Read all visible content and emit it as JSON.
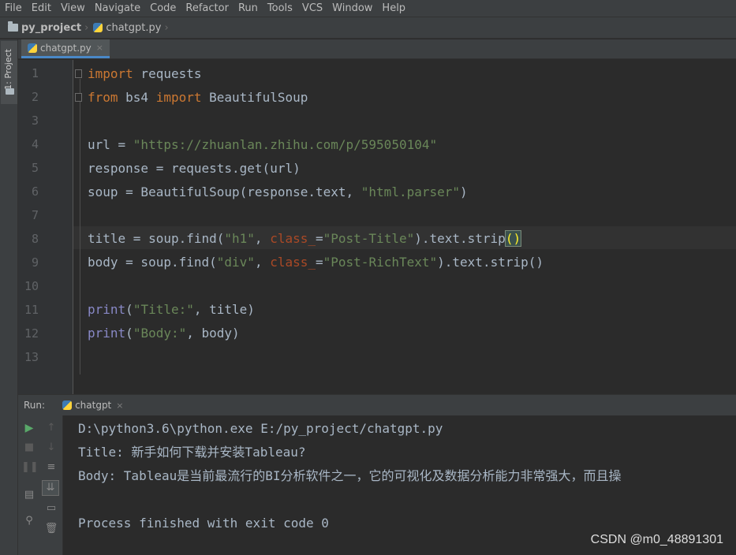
{
  "menu": [
    "File",
    "Edit",
    "View",
    "Navigate",
    "Code",
    "Refactor",
    "Run",
    "Tools",
    "VCS",
    "Window",
    "Help"
  ],
  "breadcrumb": {
    "project": "py_project",
    "file": "chatgpt.py"
  },
  "left_tool": {
    "project_label": "1: Project"
  },
  "editor": {
    "tab_label": "chatgpt.py",
    "close_glyph": "×",
    "line_numbers": [
      "1",
      "2",
      "3",
      "4",
      "5",
      "6",
      "7",
      "8",
      "9",
      "10",
      "11",
      "12",
      "13"
    ],
    "code": {
      "l1_kw": "import",
      "l1_rest": " requests",
      "l2_kw1": "from",
      "l2_mid": " bs4 ",
      "l2_kw2": "import",
      "l2_rest": " BeautifulSoup",
      "l4_a": "url = ",
      "l4_str": "\"https://zhuanlan.zhihu.com/p/595050104\"",
      "l5": "response = requests.get(url)",
      "l6_a": "soup = BeautifulSoup(response.text, ",
      "l6_str": "\"html.parser\"",
      "l6_b": ")",
      "l8_a": "title = soup.find(",
      "l8_s1": "\"h1\"",
      "l8_c": ", ",
      "l8_p": "class_",
      "l8_eq": "=",
      "l8_s2": "\"Post-Title\"",
      "l8_b": ").text.strip",
      "l8_br": "()",
      "l9_a": "body = soup.find(",
      "l9_s1": "\"div\"",
      "l9_c": ", ",
      "l9_p": "class_",
      "l9_eq": "=",
      "l9_s2": "\"Post-RichText\"",
      "l9_b": ").text.strip()",
      "l11_f": "print",
      "l11_a": "(",
      "l11_s": "\"Title:\"",
      "l11_b": ", title)",
      "l12_f": "print",
      "l12_a": "(",
      "l12_s": "\"Body:\"",
      "l12_b": ", body)"
    }
  },
  "run": {
    "label": "Run:",
    "tab_label": "chatgpt",
    "close_glyph": "×",
    "console": [
      "D:\\python3.6\\python.exe E:/py_project/chatgpt.py",
      "Title: 新手如何下载并安装Tableau?",
      "Body: Tableau是当前最流行的BI分析软件之一，它的可视化及数据分析能力非常强大，而且操",
      "",
      "Process finished with exit code 0"
    ]
  },
  "watermark": "CSDN @m0_48891301",
  "colors": {
    "keyword": "#cc7832",
    "string": "#6a8759",
    "builtin": "#8888c6",
    "param": "#aa4926",
    "text": "#a9b7c6"
  }
}
